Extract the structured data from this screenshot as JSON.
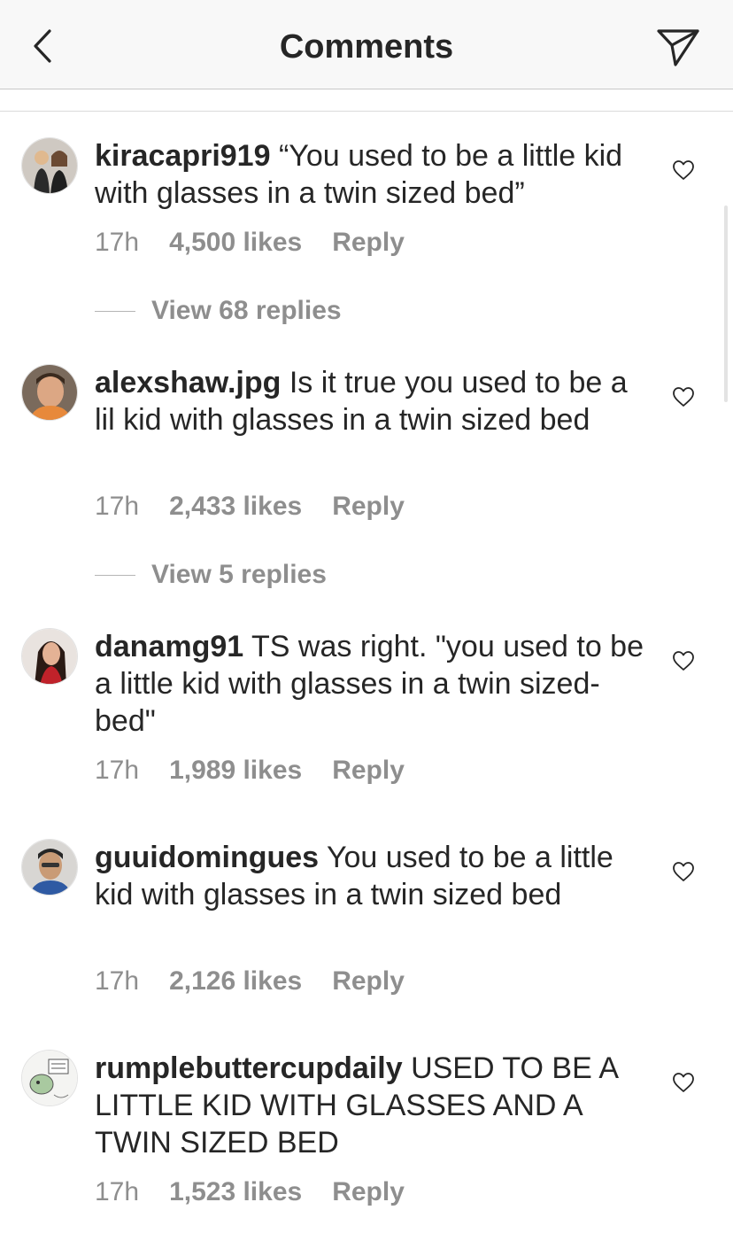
{
  "header": {
    "title": "Comments",
    "back_icon": "chevron-left-icon",
    "send_icon": "paper-plane-icon"
  },
  "colors": {
    "text": "#262626",
    "secondary": "#8e8e8e",
    "header_bg": "#f8f8f8"
  },
  "comments": [
    {
      "username": "kiracapri919",
      "text": "“You used to be a little kid with glasses in a twin sized bed”",
      "time": "17h",
      "likes": "4,500 likes",
      "reply": "Reply",
      "view_replies": "View 68 replies"
    },
    {
      "username": "alexshaw.jpg",
      "text": "Is it true you used to be a lil kid with glasses in a twin sized bed",
      "time": "17h",
      "likes": "2,433 likes",
      "reply": "Reply",
      "view_replies": "View 5 replies"
    },
    {
      "username": "danamg91",
      "text": "TS was right. \"you used to be a little kid with glasses in a twin sized-bed\"",
      "time": "17h",
      "likes": "1,989 likes",
      "reply": "Reply"
    },
    {
      "username": "guuidomingues",
      "text": "You used to be a little kid with glasses in a twin sized bed",
      "time": "17h",
      "likes": "2,126 likes",
      "reply": "Reply"
    },
    {
      "username": "rumplebuttercupdaily",
      "text": "USED TO BE A LITTLE KID WITH GLASSES AND A TWIN SIZED BED",
      "time": "17h",
      "likes": "1,523 likes",
      "reply": "Reply"
    }
  ]
}
